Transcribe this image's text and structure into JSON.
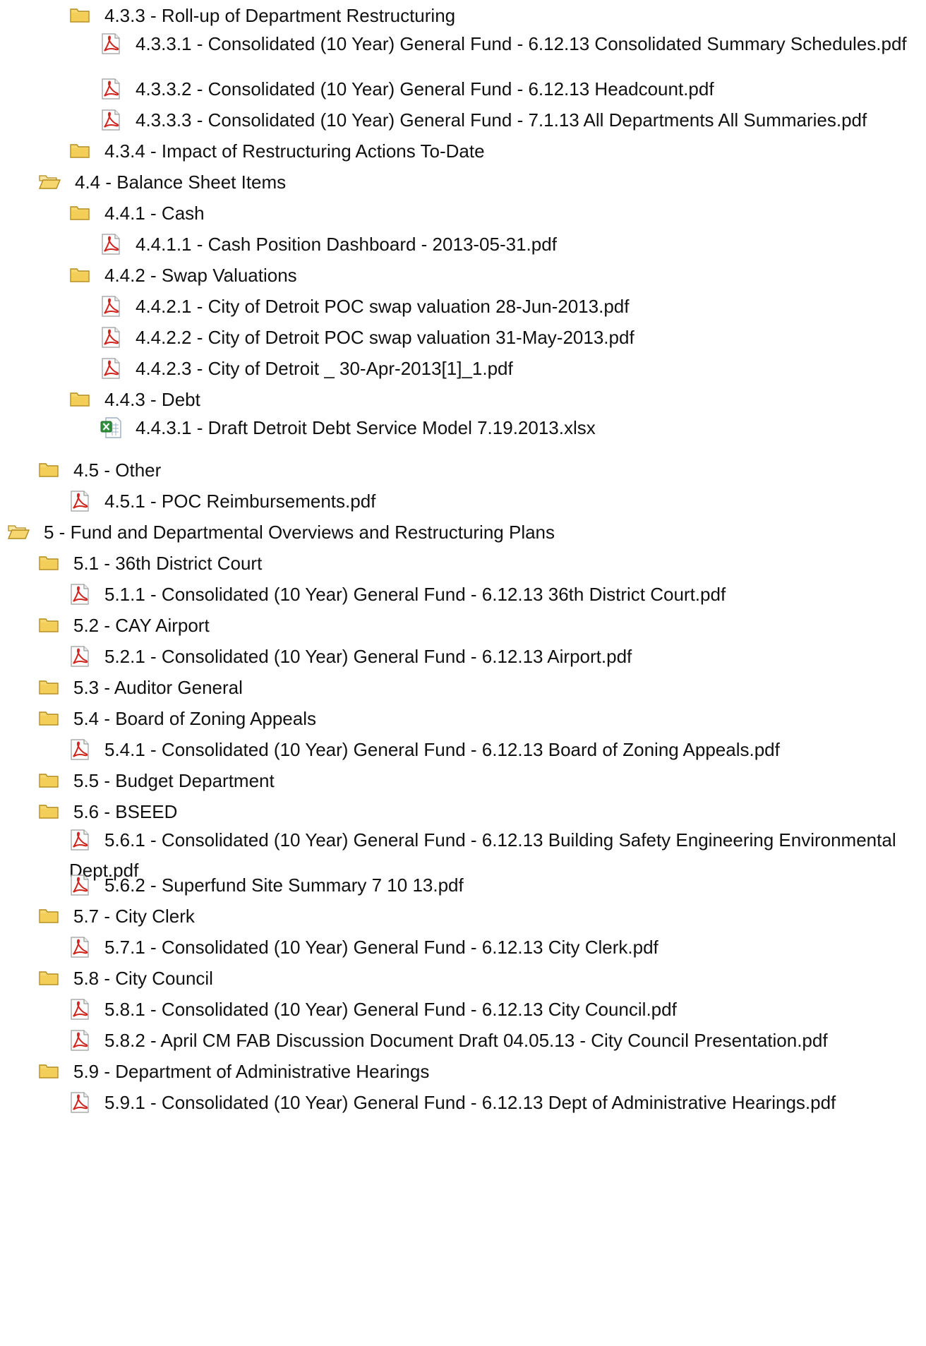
{
  "tree": {
    "items": [
      {
        "type": "folder",
        "icon": "folder-closed-icon",
        "level": 2,
        "text": "4.3.3 - Roll-up of Department Restructuring"
      },
      {
        "type": "pdf",
        "icon": "pdf-file-icon",
        "level": 3,
        "text": "4.3.3.1 - Consolidated (10 Year) General Fund - 6.12.13 Consolidated Summary Schedules.pdf",
        "wrap": true
      },
      {
        "type": "pdf",
        "icon": "pdf-file-icon",
        "level": 3,
        "text": "4.3.3.2 - Consolidated (10 Year) General Fund - 6.12.13 Headcount.pdf"
      },
      {
        "type": "pdf",
        "icon": "pdf-file-icon",
        "level": 3,
        "text": "4.3.3.3 - Consolidated (10 Year) General Fund - 7.1.13 All Departments All Summaries.pdf"
      },
      {
        "type": "folder",
        "icon": "folder-closed-icon",
        "level": 2,
        "text": "4.3.4 - Impact of Restructuring Actions To-Date"
      },
      {
        "type": "folder-open",
        "icon": "folder-open-icon",
        "level": 1,
        "text": "4.4 - Balance Sheet Items"
      },
      {
        "type": "folder",
        "icon": "folder-closed-icon",
        "level": 2,
        "text": "4.4.1 - Cash"
      },
      {
        "type": "pdf",
        "icon": "pdf-file-icon",
        "level": 3,
        "text": "4.4.1.1 - Cash Position Dashboard - 2013-05-31.pdf"
      },
      {
        "type": "folder",
        "icon": "folder-closed-icon",
        "level": 2,
        "text": "4.4.2 - Swap Valuations"
      },
      {
        "type": "pdf",
        "icon": "pdf-file-icon",
        "level": 3,
        "text": "4.4.2.1 - City of Detroit POC swap valuation 28-Jun-2013.pdf"
      },
      {
        "type": "pdf",
        "icon": "pdf-file-icon",
        "level": 3,
        "text": "4.4.2.2 - City of Detroit POC swap valuation 31-May-2013.pdf"
      },
      {
        "type": "pdf",
        "icon": "pdf-file-icon",
        "level": 3,
        "text": "4.4.2.3 - City of Detroit _ 30-Apr-2013[1]_1.pdf"
      },
      {
        "type": "folder",
        "icon": "folder-closed-icon",
        "level": 2,
        "text": "4.4.3 - Debt"
      },
      {
        "type": "xlsx",
        "icon": "excel-file-icon",
        "level": 3,
        "text": "4.4.3.1 - Draft Detroit Debt Service Model 7.19.2013.xlsx"
      },
      {
        "type": "folder",
        "icon": "folder-closed-icon",
        "level": 1,
        "text": "4.5 - Other"
      },
      {
        "type": "pdf",
        "icon": "pdf-file-icon",
        "level": 2,
        "text": "4.5.1 - POC Reimbursements.pdf"
      },
      {
        "type": "folder-open",
        "icon": "folder-open-icon",
        "level": 0,
        "text": "5 - Fund and Departmental Overviews and Restructuring Plans"
      },
      {
        "type": "folder",
        "icon": "folder-closed-icon",
        "level": 1,
        "text": "5.1 - 36th District Court"
      },
      {
        "type": "pdf",
        "icon": "pdf-file-icon",
        "level": 2,
        "text": "5.1.1 - Consolidated (10 Year) General Fund - 6.12.13 36th District Court.pdf"
      },
      {
        "type": "folder",
        "icon": "folder-closed-icon",
        "level": 1,
        "text": "5.2 - CAY Airport"
      },
      {
        "type": "pdf",
        "icon": "pdf-file-icon",
        "level": 2,
        "text": "5.2.1 - Consolidated (10 Year) General Fund - 6.12.13 Airport.pdf"
      },
      {
        "type": "folder",
        "icon": "folder-closed-icon",
        "level": 1,
        "text": "5.3 - Auditor General"
      },
      {
        "type": "folder",
        "icon": "folder-closed-icon",
        "level": 1,
        "text": "5.4 - Board of Zoning Appeals"
      },
      {
        "type": "pdf",
        "icon": "pdf-file-icon",
        "level": 2,
        "text": "5.4.1 - Consolidated (10 Year) General Fund - 6.12.13 Board of Zoning Appeals.pdf"
      },
      {
        "type": "folder",
        "icon": "folder-closed-icon",
        "level": 1,
        "text": "5.5 - Budget Department"
      },
      {
        "type": "folder",
        "icon": "folder-closed-icon",
        "level": 1,
        "text": "5.6 - BSEED"
      },
      {
        "type": "pdf",
        "icon": "pdf-file-icon",
        "level": 2,
        "text": "5.6.1 - Consolidated (10 Year) General Fund - 6.12.13 Building Safety Engineering Environmental Dept.pdf",
        "wrap": true
      },
      {
        "type": "pdf",
        "icon": "pdf-file-icon",
        "level": 2,
        "text": "5.6.2 - Superfund Site Summary 7 10 13.pdf"
      },
      {
        "type": "folder",
        "icon": "folder-closed-icon",
        "level": 1,
        "text": "5.7 - City Clerk"
      },
      {
        "type": "pdf",
        "icon": "pdf-file-icon",
        "level": 2,
        "text": "5.7.1 - Consolidated (10 Year) General Fund - 6.12.13 City Clerk.pdf"
      },
      {
        "type": "folder",
        "icon": "folder-closed-icon",
        "level": 1,
        "text": "5.8 - City Council"
      },
      {
        "type": "pdf",
        "icon": "pdf-file-icon",
        "level": 2,
        "text": "5.8.1 - Consolidated (10 Year) General Fund - 6.12.13 City Council.pdf"
      },
      {
        "type": "pdf",
        "icon": "pdf-file-icon",
        "level": 2,
        "text": "5.8.2 - April CM FAB Discussion Document Draft 04.05.13 - City Council Presentation.pdf"
      },
      {
        "type": "folder",
        "icon": "folder-closed-icon",
        "level": 1,
        "text": "5.9 - Department of Administrative Hearings"
      },
      {
        "type": "pdf",
        "icon": "pdf-file-icon",
        "level": 2,
        "text": "5.9.1 - Consolidated (10 Year) General Fund - 6.12.13 Dept of Administrative Hearings.pdf"
      }
    ]
  },
  "colors": {
    "text": "#111111",
    "background": "#ffffff",
    "folder_fill": "#f6d66e",
    "folder_stroke": "#b28a1c",
    "pdf_red": "#d0261f",
    "excel_green": "#2f8f3a"
  }
}
